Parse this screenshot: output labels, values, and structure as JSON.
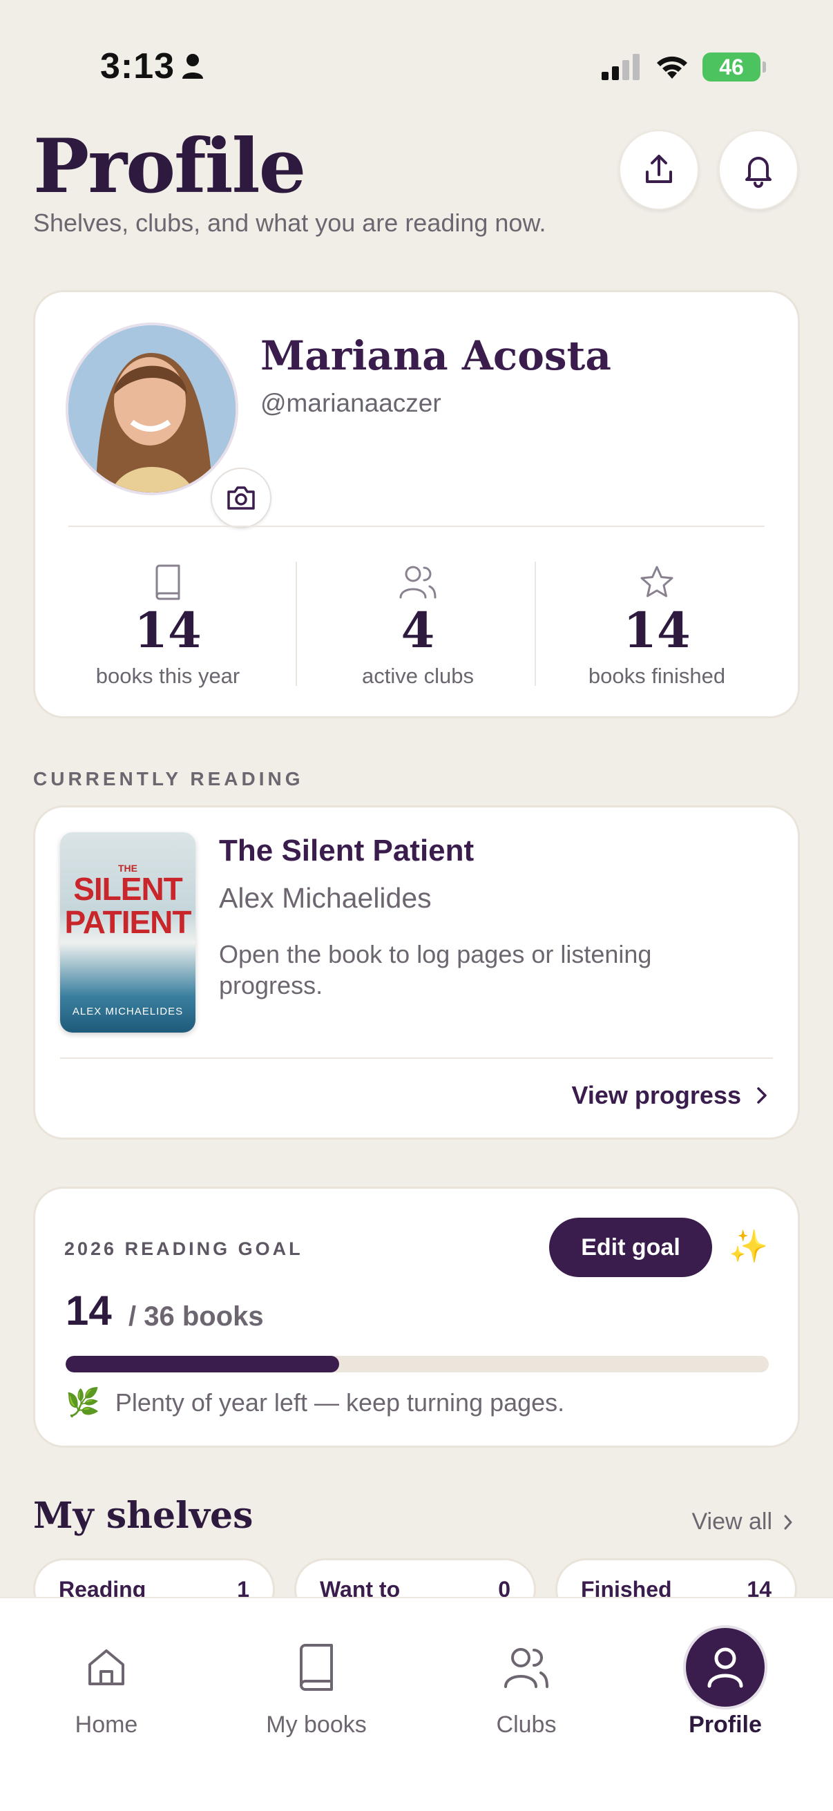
{
  "status_bar": {
    "time": "3:13",
    "battery": "46"
  },
  "header": {
    "title": "Profile",
    "subtitle": "Shelves, clubs, and what you are reading now."
  },
  "profile": {
    "name": "Mariana Acosta",
    "handle": "@marianaaczer",
    "stats": [
      {
        "value": "14",
        "label": "books this year",
        "icon": "book-icon"
      },
      {
        "value": "4",
        "label": "active clubs",
        "icon": "users-icon"
      },
      {
        "value": "14",
        "label": "books finished",
        "icon": "star-icon"
      }
    ]
  },
  "currently_reading": {
    "section_label": "CURRENTLY READING",
    "cover_the": "THE",
    "cover_title": "SILENT PATIENT",
    "cover_author": "ALEX MICHAELIDES",
    "title": "The Silent Patient",
    "author": "Alex Michaelides",
    "note": "Open the book to log pages or listening progress.",
    "action": "View progress"
  },
  "goal": {
    "label": "2026 READING GOAL",
    "edit_label": "Edit goal",
    "count": "14",
    "total": "/ 36 books",
    "progress_fraction": 0.389,
    "message": "Plenty of year left — keep turning pages."
  },
  "shelves": {
    "title": "My shelves",
    "view_all": "View all",
    "chips": [
      {
        "label": "Reading",
        "count": "1"
      },
      {
        "label": "Want to",
        "count": "0"
      },
      {
        "label": "Finished",
        "count": "14"
      }
    ]
  },
  "tabs": [
    {
      "label": "Home",
      "icon": "home-icon"
    },
    {
      "label": "My books",
      "icon": "book-icon"
    },
    {
      "label": "Clubs",
      "icon": "users-icon"
    },
    {
      "label": "Profile",
      "icon": "user-icon",
      "active": true
    }
  ],
  "colors": {
    "primary": "#3a1d4d",
    "background": "#f1eee8",
    "muted": "#6d6670"
  }
}
